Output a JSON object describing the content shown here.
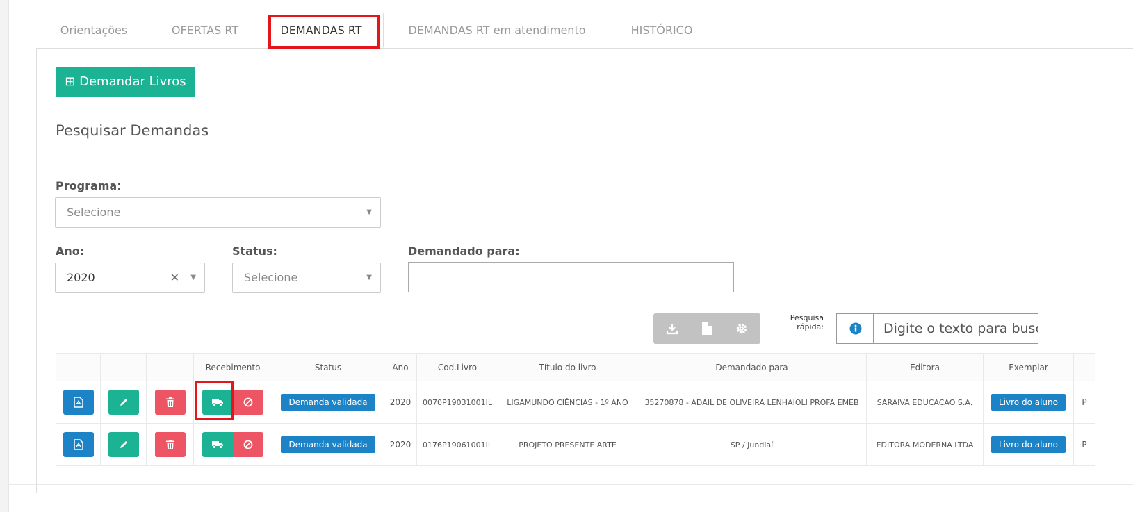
{
  "tabs": [
    {
      "label": "Orientações"
    },
    {
      "label": "OFERTAS RT"
    },
    {
      "label": "DEMANDAS RT"
    },
    {
      "label": "DEMANDAS RT em atendimento"
    },
    {
      "label": "HISTÓRICO"
    }
  ],
  "active_tab": "DEMANDAS RT",
  "demandar_button": {
    "icon": "⊞",
    "label": "Demandar Livros"
  },
  "section_title": "Pesquisar Demandas",
  "filters": {
    "programa": {
      "label": "Programa:",
      "placeholder": "Selecione"
    },
    "ano": {
      "label": "Ano:",
      "value": "2020"
    },
    "status": {
      "label": "Status:",
      "placeholder": "Selecione"
    },
    "demandado_para": {
      "label": "Demandado para:",
      "value": ""
    }
  },
  "toolbar": {
    "icons": [
      "download-icon",
      "file-icon",
      "gear-icon"
    ]
  },
  "quick_search": {
    "label_line1": "Pesquisa",
    "label_line2": "rápida:",
    "placeholder": "Digite o texto para busc"
  },
  "table": {
    "headers": [
      "",
      "",
      "",
      "Recebimento",
      "Status",
      "Ano",
      "Cod.Livro",
      "Título do livro",
      "Demandado para",
      "Editora",
      "Exemplar",
      ""
    ],
    "rows": [
      {
        "status": "Demanda validada",
        "ano": "2020",
        "cod": "0070P19031001IL",
        "titulo": "LIGAMUNDO CIÊNCIAS - 1º ANO",
        "demandado": "35270878 - ADAIL DE OLIVEIRA LENHAIOLI PROFA EMEB",
        "editora": "SARAIVA EDUCACAO S.A.",
        "exemplar": "Livro do aluno",
        "extra": "P"
      },
      {
        "status": "Demanda validada",
        "ano": "2020",
        "cod": "0176P19061001IL",
        "titulo": "PROJETO PRESENTE ARTE",
        "demandado": "SP / Jundiaí",
        "editora": "EDITORA MODERNA LTDA",
        "exemplar": "Livro do aluno",
        "extra": "P"
      }
    ]
  },
  "colors": {
    "accent_green": "#1bb394",
    "primary_blue": "#1c84c6",
    "danger_red": "#ed5565",
    "highlight": "#e3161b"
  }
}
